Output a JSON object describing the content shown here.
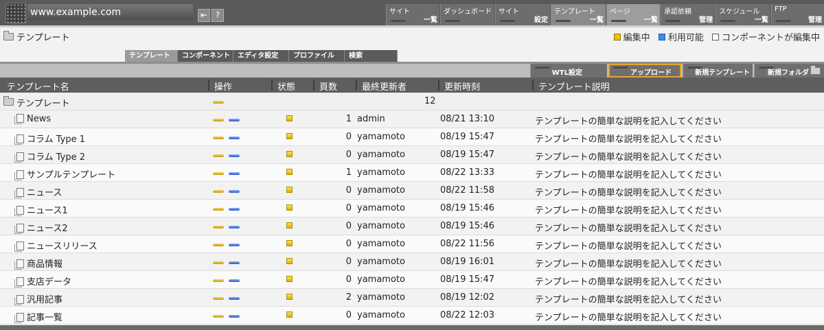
{
  "header": {
    "site_name": "www.example.com",
    "nav": [
      {
        "top": "サイト",
        "bottom": "一覧"
      },
      {
        "top": "ダッシュボード",
        "bottom": ""
      },
      {
        "top": "サイト",
        "bottom": "設定"
      },
      {
        "top": "テンプレート",
        "bottom": "一覧"
      },
      {
        "top": "ページ",
        "bottom": "一覧"
      },
      {
        "top": "承認依頼",
        "bottom": "管理"
      },
      {
        "top": "スケジュール",
        "bottom": "一覧"
      },
      {
        "top": "FTP",
        "bottom": "管理"
      }
    ],
    "icons": [
      "logout-icon",
      "help-icon"
    ],
    "help_glyph": "?"
  },
  "page": {
    "title": "テンプレート",
    "legend": [
      {
        "label": "編集中",
        "color": "#f2c200"
      },
      {
        "label": "利用可能",
        "color": "#3a8ee6"
      },
      {
        "label": "コンポーネントが編集中",
        "color": "#ffffff"
      }
    ]
  },
  "tabs": [
    "テンプレート",
    "コンポーネント",
    "エディタ設定",
    "プロファイル",
    "検索"
  ],
  "actions": [
    "WTL設定",
    "アップロード",
    "新規テンプレート",
    "新規フォルダ"
  ],
  "table": {
    "columns": [
      "テンプレート名",
      "操作",
      "状態",
      "頁数",
      "最終更新者",
      "更新時刻",
      "テンプレート説明"
    ],
    "parent": {
      "name": "テンプレート",
      "count": "12"
    },
    "rows": [
      {
        "name": "News",
        "pages": "1",
        "user": "admin",
        "time": "08/21 13:10",
        "desc": "テンプレートの簡単な説明を記入してください"
      },
      {
        "name": "コラム Type 1",
        "pages": "0",
        "user": "yamamoto",
        "time": "08/19 15:47",
        "desc": "テンプレートの簡単な説明を記入してください"
      },
      {
        "name": "コラム Type 2",
        "pages": "0",
        "user": "yamamoto",
        "time": "08/19 15:47",
        "desc": "テンプレートの簡単な説明を記入してください"
      },
      {
        "name": "サンプルテンプレート",
        "pages": "1",
        "user": "yamamoto",
        "time": "08/22 13:33",
        "desc": "テンプレートの簡単な説明を記入してください"
      },
      {
        "name": "ニュース",
        "pages": "0",
        "user": "yamamoto",
        "time": "08/22 11:58",
        "desc": "テンプレートの簡単な説明を記入してください"
      },
      {
        "name": "ニュース1",
        "pages": "0",
        "user": "yamamoto",
        "time": "08/19 15:46",
        "desc": "テンプレートの簡単な説明を記入してください"
      },
      {
        "name": "ニュース2",
        "pages": "0",
        "user": "yamamoto",
        "time": "08/19 15:46",
        "desc": "テンプレートの簡単な説明を記入してください"
      },
      {
        "name": "ニュースリリース",
        "pages": "0",
        "user": "yamamoto",
        "time": "08/22 11:56",
        "desc": "テンプレートの簡単な説明を記入してください"
      },
      {
        "name": "商品情報",
        "pages": "0",
        "user": "yamamoto",
        "time": "08/19 16:01",
        "desc": "テンプレートの簡単な説明を記入してください"
      },
      {
        "name": "支店データ",
        "pages": "0",
        "user": "yamamoto",
        "time": "08/19 15:47",
        "desc": "テンプレートの簡単な説明を記入してください"
      },
      {
        "name": "汎用記事",
        "pages": "2",
        "user": "yamamoto",
        "time": "08/19 12:02",
        "desc": "テンプレートの簡単な説明を記入してください"
      },
      {
        "name": "記事一覧",
        "pages": "0",
        "user": "yamamoto",
        "time": "08/22 12:03",
        "desc": "テンプレートの簡単な説明を記入してください"
      }
    ]
  }
}
